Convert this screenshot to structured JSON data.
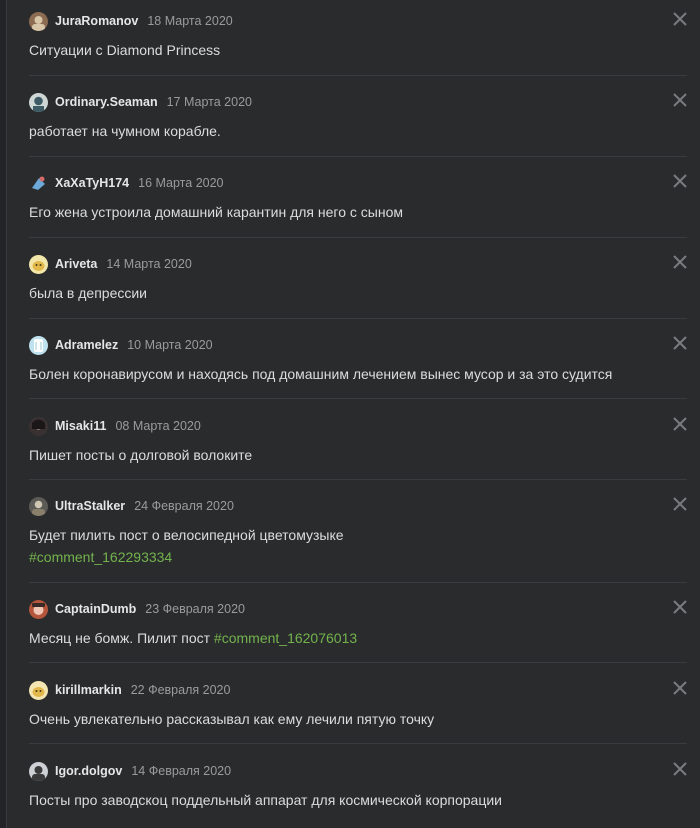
{
  "comments": [
    {
      "user": "JuraRomanov",
      "date": "18 Марта 2020",
      "text": "Ситуации с Diamond Princess",
      "link": "",
      "avatar": {
        "bg": "#8b6b52",
        "fg": "#d8c6a8"
      }
    },
    {
      "user": "Ordinary.Seaman",
      "date": "17 Марта 2020",
      "text": "работает на чумном корабле.",
      "link": "",
      "avatar": {
        "bg": "#cfd7d5",
        "fg": "#3c5b65"
      }
    },
    {
      "user": "XaXaTyH174",
      "date": "16 Марта 2020",
      "text": "Его жена устроила домашний карантин для него с сыном",
      "link": "",
      "avatar": {
        "bg": "#2a2b2d",
        "fg": "#6ca8d8"
      }
    },
    {
      "user": "Ariveta",
      "date": "14 Марта 2020",
      "text": "была в депрессии",
      "link": "",
      "avatar": {
        "bg": "#f3e6a9",
        "fg": "#e2b84b"
      }
    },
    {
      "user": "Adramelez",
      "date": "10 Марта 2020",
      "text": "Болен коронавирусом и находясь под домашним лечением вынес мусор и за это судится",
      "link": "",
      "avatar": {
        "bg": "#bfe3ee",
        "fg": "#ffffff"
      }
    },
    {
      "user": "Misaki11",
      "date": "08 Марта 2020",
      "text": "Пишет посты о долговой волоките",
      "link": "",
      "avatar": {
        "bg": "#3a3132",
        "fg": "#e5d6d6"
      }
    },
    {
      "user": "UltraStalker",
      "date": "24 Февраля 2020",
      "text": "Будет пилить пост о велосипедной цветомузыке",
      "link": "#comment_162293334",
      "avatar": {
        "bg": "#5b5a56",
        "fg": "#cfc6b2"
      }
    },
    {
      "user": "CaptainDumb",
      "date": "23 Февраля 2020",
      "text": "Месяц не бомж. Пилит пост ",
      "link": "#comment_162076013",
      "avatar": {
        "bg": "#b5553b",
        "fg": "#f0c7b6"
      }
    },
    {
      "user": "kirillmarkin",
      "date": "22 Февраля 2020",
      "text": "Очень увлекательно рассказывал как ему лечили пятую точку",
      "link": "",
      "avatar": {
        "bg": "#f4e6b2",
        "fg": "#e2b84b"
      }
    },
    {
      "user": "Igor.dolgov",
      "date": "14 Февраля 2020",
      "text": "Посты про заводскоц поддельный аппарат для космической корпорации",
      "link": "",
      "avatar": {
        "bg": "#cdd0d4",
        "fg": "#3a3a3a"
      }
    }
  ],
  "colors": {
    "link": "#73b34d",
    "close": "#7a7b7e"
  },
  "icons": {
    "close": "close-icon"
  }
}
